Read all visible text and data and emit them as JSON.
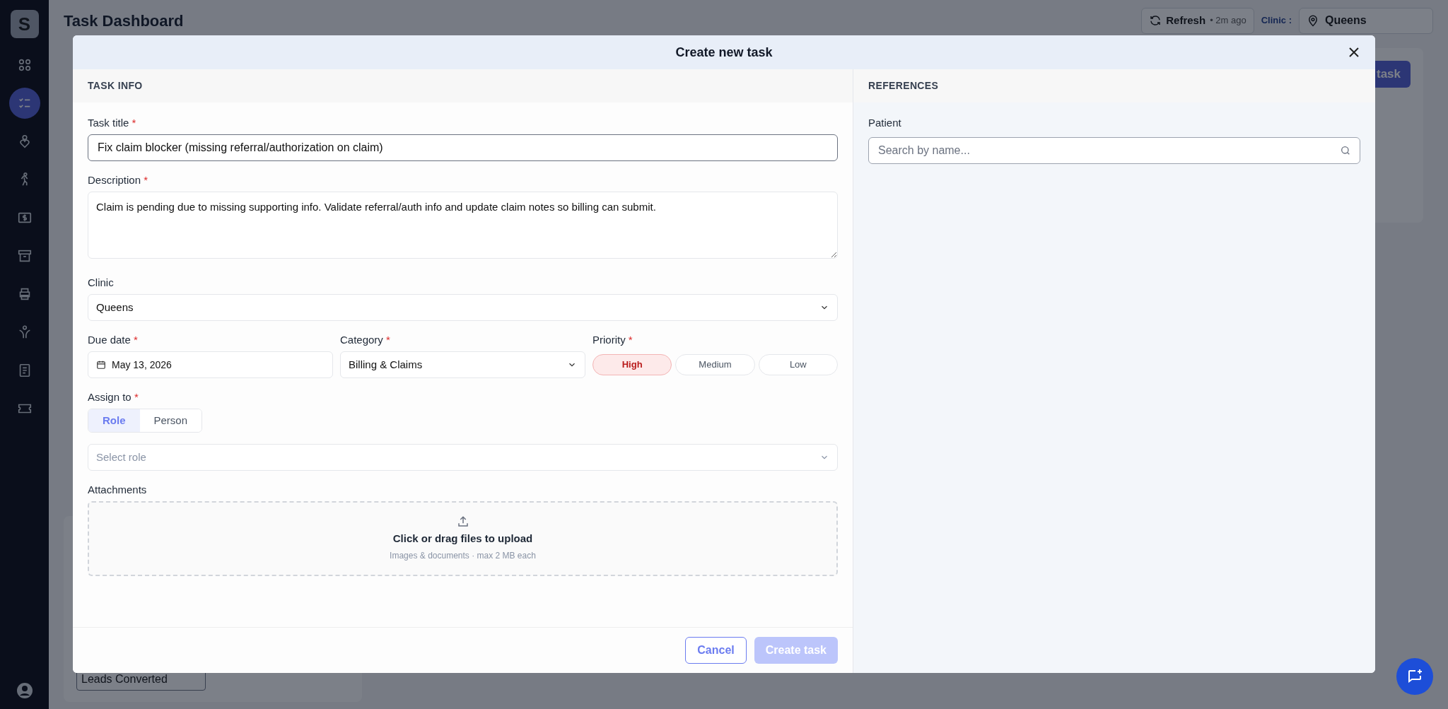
{
  "sidebar": {
    "items": [
      {
        "selected": false
      },
      {
        "selected": true
      },
      {
        "selected": false
      },
      {
        "selected": false
      },
      {
        "selected": false
      },
      {
        "selected": false
      },
      {
        "selected": false
      },
      {
        "selected": false
      },
      {
        "selected": false
      },
      {
        "selected": false
      }
    ],
    "logo": "S"
  },
  "header": {
    "title": "Task Dashboard",
    "refresh": {
      "label": "Refresh",
      "age": "• 2m ago"
    },
    "clinic_label": "Clinic :",
    "clinic_value": "Queens"
  },
  "background": {
    "button_label": "task",
    "field_value": "Leads Converted"
  },
  "modal": {
    "title": "Create new task",
    "task_info": {
      "heading": "TASK INFO",
      "task_title": {
        "label": "Task title",
        "required_mark": "*",
        "value": "Fix claim blocker (missing referral/authorization on claim)"
      },
      "description": {
        "label": "Description",
        "required_mark": "*",
        "value": "Claim is pending due to missing supporting info. Validate referral/auth info and update claim notes so billing can submit."
      },
      "clinic": {
        "label": "Clinic",
        "value": "Queens"
      },
      "due_date": {
        "label": "Due date",
        "required_mark": "*",
        "value": "May 13, 2026"
      },
      "category": {
        "label": "Category",
        "required_mark": "*",
        "value": "Billing & Claims"
      },
      "priority": {
        "label": "Priority",
        "required_mark": "*",
        "options": [
          {
            "label": "High",
            "selected": true
          },
          {
            "label": "Medium",
            "selected": false
          },
          {
            "label": "Low",
            "selected": false
          }
        ]
      },
      "assign_to": {
        "label": "Assign to",
        "required_mark": "*",
        "options": [
          {
            "label": "Role",
            "selected": true
          },
          {
            "label": "Person",
            "selected": false
          }
        ],
        "placeholder": "Select role"
      },
      "attachments": {
        "label": "Attachments",
        "title": "Click or drag files to upload",
        "hint": "Images & documents · max 2 MB each"
      }
    },
    "references": {
      "heading": "REFERENCES",
      "patient": {
        "label": "Patient",
        "placeholder": "Search by name..."
      }
    },
    "buttons": [
      {
        "label": "Cancel",
        "kind": "secondary",
        "disabled": false
      },
      {
        "label": "Create task",
        "kind": "primary",
        "disabled": true
      }
    ]
  }
}
